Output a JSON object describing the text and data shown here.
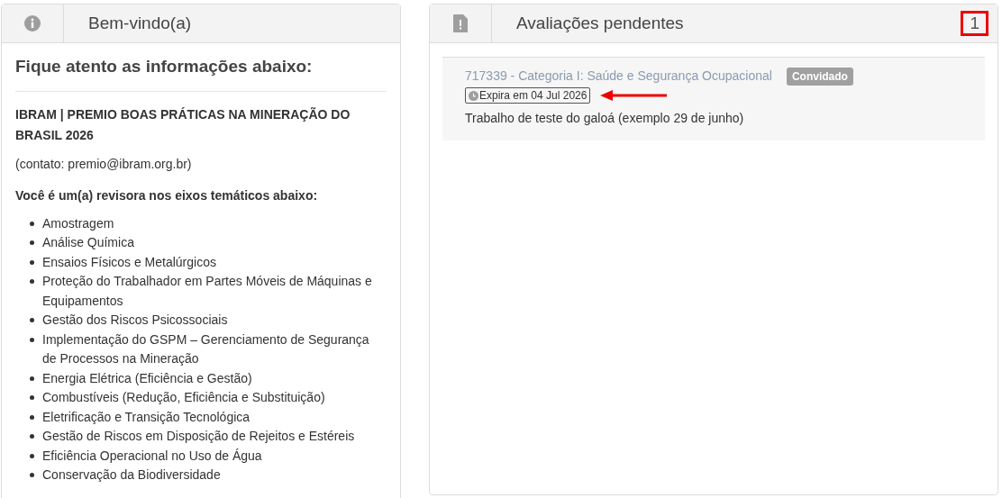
{
  "welcome_panel": {
    "title": "Bem-vindo(a)",
    "heading": "Fique atento as informações abaixo:",
    "event_title": "IBRAM | PREMIO BOAS PRÁTICAS NA MINERAÇÃO DO BRASIL 2026",
    "contact": "(contato: premio@ibram.org.br)",
    "axes_intro": "Você é um(a) revisora nos eixos temáticos abaixo:",
    "axes": [
      "Amostragem",
      "Análise Química",
      "Ensaios Físicos e Metalúrgicos",
      "Proteção do Trabalhador em Partes Móveis de Máquinas e Equipamentos",
      "Gestão dos Riscos Psicossociais",
      "Implementação do GSPM – Gerenciamento de Segurança de Processos na Mineração",
      "Energia Elétrica (Eficiência e Gestão)",
      "Combustíveis (Redução, Eficiência e Substituição)",
      "Eletrificação e Transição Tecnológica",
      "Gestão de Riscos em Disposição de Rejeitos e Estéreis",
      "Eficiência Operacional no Uso de Água",
      "Conservação da Biodiversidade"
    ]
  },
  "pending_panel": {
    "title": "Avaliações pendentes",
    "count": "1",
    "count_highlighted": true,
    "reviews": [
      {
        "link": "717339 - Categoria I: Saúde e Segurança Ocupacional",
        "status": "Convidado",
        "expiry": "Expira em 04 Jul 2026",
        "expiry_arrow": true,
        "work_title": "Trabalho de teste do galoá (exemplo 29 de junho)"
      }
    ]
  }
}
